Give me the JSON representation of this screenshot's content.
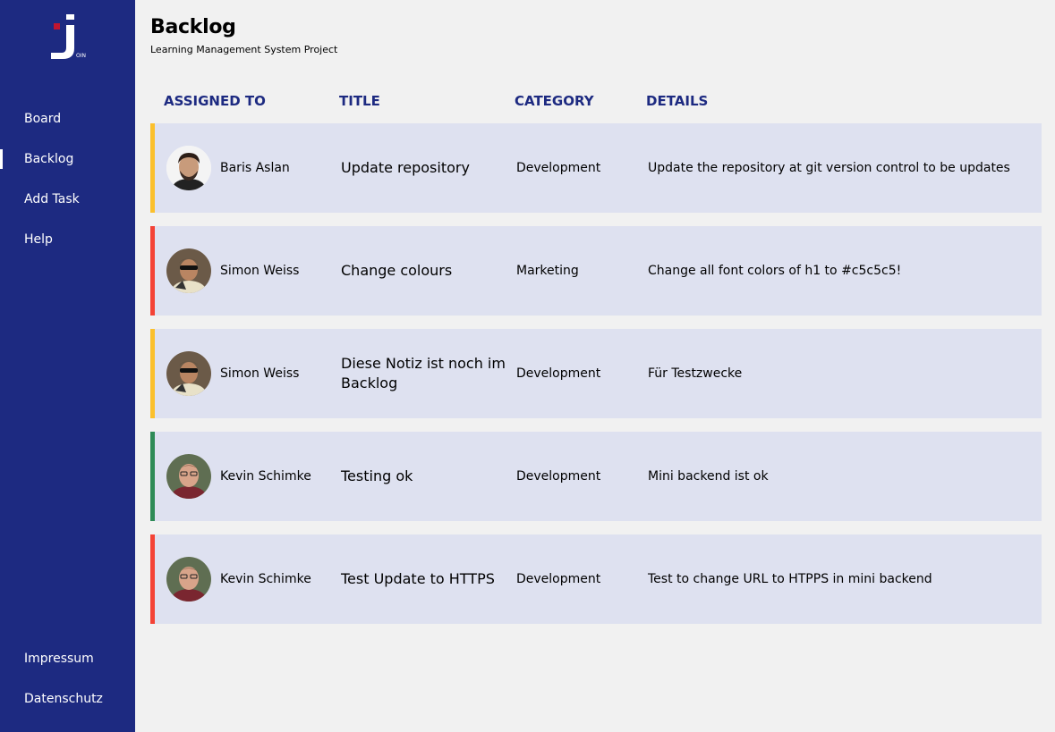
{
  "sidebar": {
    "logo_text": "OIN",
    "nav": [
      {
        "label": "Board"
      },
      {
        "label": "Backlog",
        "active": true
      },
      {
        "label": "Add Task"
      },
      {
        "label": "Help"
      }
    ],
    "footer": [
      {
        "label": "Impressum"
      },
      {
        "label": "Datenschutz"
      }
    ]
  },
  "header": {
    "title": "Backlog",
    "subtitle": "Learning Management System Project"
  },
  "table": {
    "columns": [
      "ASSIGNED TO",
      "TITLE",
      "CATEGORY",
      "DETAILS"
    ],
    "rows": [
      {
        "assignee": "Baris Aslan",
        "title": "Update repository",
        "category": "Development",
        "details": "Update the repository at git version control to be updates",
        "priority_color": "#fbc02d",
        "avatar": "avatar-baris"
      },
      {
        "assignee": "Simon Weiss",
        "title": "Change colours",
        "category": "Marketing",
        "details": "Change all font colors of h1 to #c5c5c5!",
        "priority_color": "#f44336",
        "avatar": "avatar-simon"
      },
      {
        "assignee": "Simon Weiss",
        "title": "Diese Notiz ist noch im Backlog",
        "category": "Development",
        "details": "Für Testzwecke",
        "priority_color": "#fbc02d",
        "avatar": "avatar-simon"
      },
      {
        "assignee": "Kevin Schimke",
        "title": "Testing ok",
        "category": "Development",
        "details": "Mini backend ist ok",
        "priority_color": "#2e8b57",
        "avatar": "avatar-kevin"
      },
      {
        "assignee": "Kevin Schimke",
        "title": "Test Update to HTTPS",
        "category": "Development",
        "details": "Test to change URL to HTPPS in mini backend",
        "priority_color": "#f44336",
        "avatar": "avatar-kevin"
      }
    ]
  },
  "colors": {
    "sidebar_bg": "#1d2a81",
    "row_bg": "#dee1f0",
    "header_text": "#1d2a81"
  }
}
